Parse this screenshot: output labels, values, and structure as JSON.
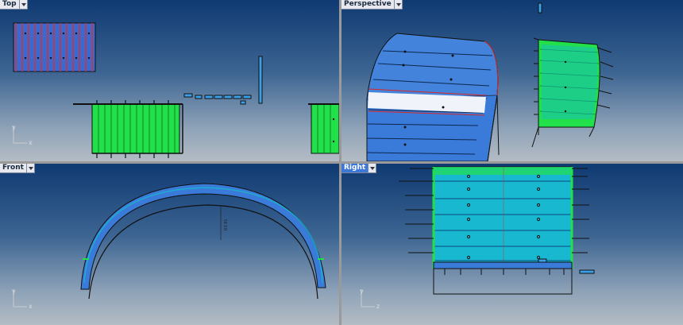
{
  "viewports": {
    "top": {
      "label": "Top",
      "active": false
    },
    "perspective": {
      "label": "Perspective",
      "active": false
    },
    "front": {
      "label": "Front",
      "active": false
    },
    "right": {
      "label": "Right",
      "active": true
    }
  },
  "axes": {
    "x": "x",
    "y": "y"
  },
  "annotations": {
    "front_dimension": "R3.91"
  },
  "colors": {
    "panel_green": "#22e04a",
    "panel_blue": "#3a7ad8",
    "panel_cyan": "#18b8d0",
    "panel_red": "#d82828",
    "active_tab": "#3d78d8"
  }
}
